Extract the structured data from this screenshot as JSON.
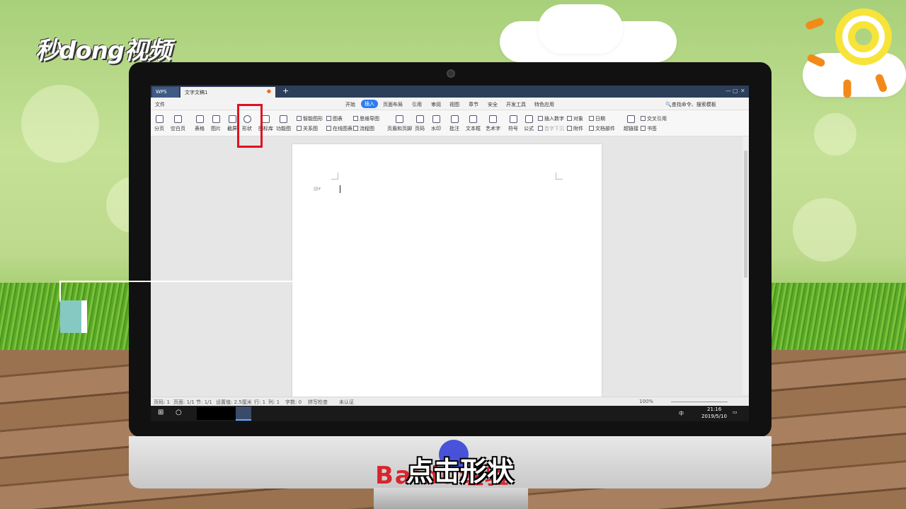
{
  "brand": {
    "logo_text": "秒dong视频"
  },
  "titlebar": {
    "wps_label": "WPS",
    "doc_tab": "文字文稿1",
    "new_tab": "+",
    "window_controls": [
      "—",
      "▢",
      "✕"
    ]
  },
  "menu": {
    "file": "文件",
    "tabs": [
      "开始",
      "插入",
      "页面布局",
      "引用",
      "审阅",
      "视图",
      "章节",
      "安全",
      "开发工具",
      "特色应用"
    ],
    "active_tab": "插入",
    "search": "查找命令、搜索模板"
  },
  "ribbon": {
    "big": [
      "分页",
      "空白页",
      "表格",
      "图片",
      "截屏",
      "形状",
      "图标库",
      "功能图",
      "页眉和页脚",
      "页码",
      "水印",
      "批注",
      "文本框",
      "艺术字",
      "符号",
      "公式",
      "超链接"
    ],
    "small": [
      "智能图形",
      "图表",
      "思维导图",
      "关系图",
      "在线图表",
      "流程图",
      "插入数字",
      "对象",
      "日期",
      "首字下沉",
      "附件",
      "文档部件",
      "交叉引用",
      "书签"
    ]
  },
  "status": {
    "items": [
      "页码: 1",
      "页面: 1/1",
      "节: 1/1",
      "设置值: 2.5厘米",
      "行: 1",
      "列: 1",
      "字数: 0",
      "拼写检查",
      "未认证"
    ],
    "zoom": "100%"
  },
  "taskbar": {
    "time": "21:16",
    "date": "2019/5/10",
    "lang": "中"
  },
  "overlay": {
    "caption": "点击形状",
    "watermark": "Baidu经验"
  },
  "colors": {
    "accent": "#2d7df0",
    "highlight": "#e01020",
    "titlebar": "#2c3e5a"
  }
}
